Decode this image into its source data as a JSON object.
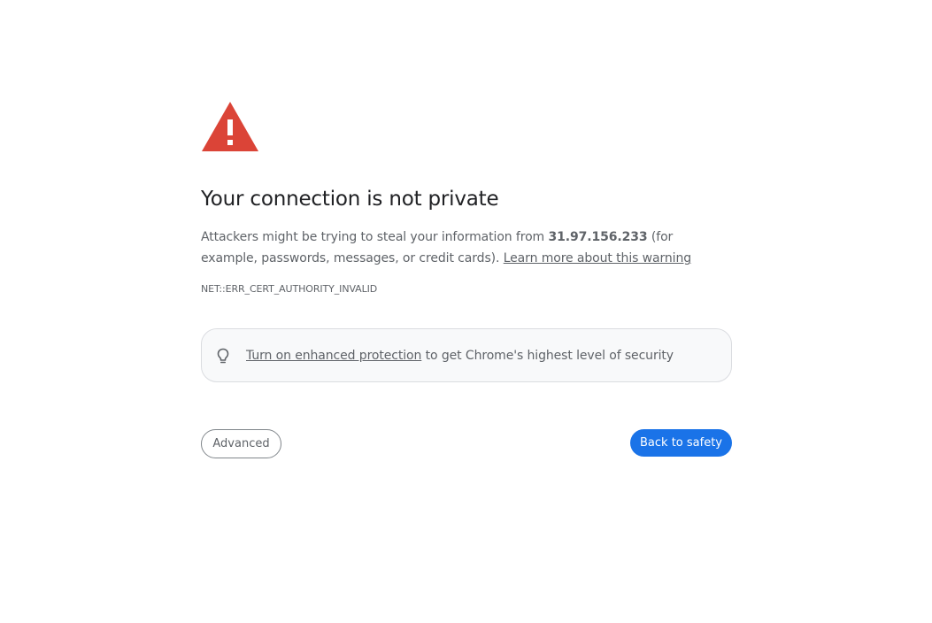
{
  "icon": "warning-triangle-icon",
  "colors": {
    "warning_red": "#db4437",
    "primary_blue": "#1a73e8",
    "text_gray": "#5f6368",
    "title_color": "#202124"
  },
  "heading": "Your connection is not private",
  "description": {
    "prefix": "Attackers might be trying to steal your information from ",
    "host": "31.97.156.233",
    "suffix": " (for example, passwords, messages, or credit cards). ",
    "learn_more_link": "Learn more about this warning"
  },
  "error_code": "NET::ERR_CERT_AUTHORITY_INVALID",
  "protection": {
    "icon": "lightbulb-icon",
    "link": "Turn on enhanced protection",
    "text": " to get Chrome's highest level of security"
  },
  "buttons": {
    "advanced": "Advanced",
    "back_to_safety": "Back to safety"
  }
}
